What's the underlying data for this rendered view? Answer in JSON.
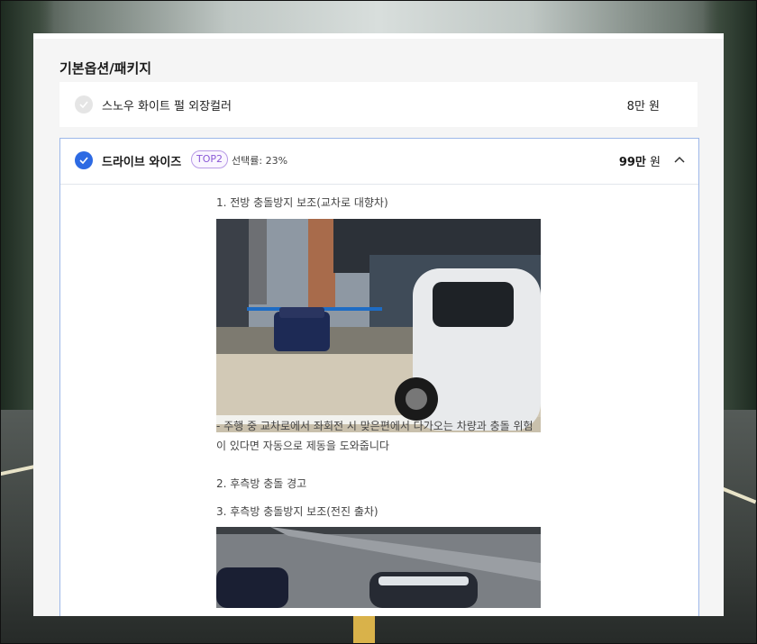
{
  "section": {
    "title": "기본옵션/패키지"
  },
  "options": [
    {
      "name": "스노우 화이트 펄 외장컬러",
      "price": "8만 원",
      "selected": false
    },
    {
      "name": "드라이브 와이즈",
      "badge": "TOP2",
      "rate_label": "선택률:",
      "rate_value": "23%",
      "price_num": "99만",
      "price_unit": "원",
      "selected": true,
      "expanded": true,
      "features": [
        "1. 전방 충돌방지 보조(교차로 대향차)",
        "- 주행 중 교차로에서 좌회전 시 맞은편에서 다가오는 차량과 충돌 위험이 있다면 자동으로 제동을 도와줍니다",
        "2. 후측방 충돌 경고",
        "3. 후측방 충돌방지 보조(전진 출차)"
      ]
    }
  ],
  "colors": {
    "accent": "#2d6ae3",
    "badge": "#8b5ad6",
    "border": "#9db7e9"
  }
}
